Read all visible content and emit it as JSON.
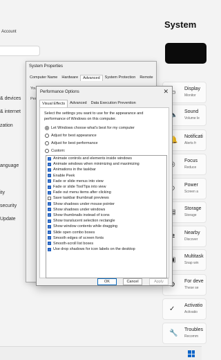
{
  "settings": {
    "account_label": "Account",
    "nav_items": [
      "& devices",
      "& internet",
      "zation",
      "anguage",
      "ity",
      "security",
      "Update"
    ],
    "system_title": "System",
    "cards": [
      {
        "icon": "display-icon",
        "glyph": "▭",
        "title": "Display",
        "sub": "Monitor"
      },
      {
        "icon": "sound-icon",
        "glyph": "🔈",
        "title": "Sound",
        "sub": "Volume le"
      },
      {
        "icon": "notifications-icon",
        "glyph": "🔔",
        "title": "Notificati",
        "sub": "Alerts fr"
      },
      {
        "icon": "focus-icon",
        "glyph": "◎",
        "title": "Focus",
        "sub": "Reduce"
      },
      {
        "icon": "power-icon",
        "glyph": "⏻",
        "title": "Power",
        "sub": "Screen a"
      },
      {
        "icon": "storage-icon",
        "glyph": "▤",
        "title": "Storage",
        "sub": "Storage"
      },
      {
        "icon": "nearby-sharing-icon",
        "glyph": "⇄",
        "title": "Nearby",
        "sub": "Discover"
      },
      {
        "icon": "multitasking-icon",
        "glyph": "▣",
        "title": "Multitask",
        "sub": "Snap win"
      },
      {
        "icon": "developers-icon",
        "glyph": "⚙",
        "title": "For deve",
        "sub": "These se"
      },
      {
        "icon": "activation-icon",
        "glyph": "✓",
        "title": "Activatio",
        "sub": "Activatio"
      },
      {
        "icon": "troubleshoot-icon",
        "glyph": "🔧",
        "title": "Troubles",
        "sub": "Recomm"
      }
    ]
  },
  "system_properties": {
    "title": "System Properties",
    "tabs": [
      "Computer Name",
      "Hardware",
      "Advanced",
      "System Protection",
      "Remote"
    ],
    "active_tab": 2,
    "body_lines": [
      "You",
      "Perfo"
    ]
  },
  "performance_options": {
    "title": "Performance Options",
    "close_glyph": "✕",
    "tabs": [
      "Visual Effects",
      "Advanced",
      "Data Execution Prevention"
    ],
    "active_tab": 0,
    "description": "Select the settings you want to use for the appearance and performance of Windows on this computer.",
    "radios": [
      {
        "label": "Let Windows choose what's best for my computer",
        "selected": true
      },
      {
        "label": "Adjust for best appearance",
        "selected": false
      },
      {
        "label": "Adjust for best performance",
        "selected": false
      },
      {
        "label": "Custom:",
        "selected": false
      }
    ],
    "options": [
      {
        "label": "Animate controls and elements inside windows",
        "checked": true
      },
      {
        "label": "Animate windows when minimizing and maximizing",
        "checked": true
      },
      {
        "label": "Animations in the taskbar",
        "checked": true
      },
      {
        "label": "Enable Peek",
        "checked": true
      },
      {
        "label": "Fade or slide menus into view",
        "checked": true
      },
      {
        "label": "Fade or slide ToolTips into view",
        "checked": true
      },
      {
        "label": "Fade out menu items after clicking",
        "checked": true
      },
      {
        "label": "Save taskbar thumbnail previews",
        "checked": false
      },
      {
        "label": "Show shadows under mouse pointer",
        "checked": true
      },
      {
        "label": "Show shadows under windows",
        "checked": true
      },
      {
        "label": "Show thumbnails instead of icons",
        "checked": true
      },
      {
        "label": "Show translucent selection rectangle",
        "checked": true
      },
      {
        "label": "Show window contents while dragging",
        "checked": true
      },
      {
        "label": "Slide open combo boxes",
        "checked": true
      },
      {
        "label": "Smooth edges of screen fonts",
        "checked": true
      },
      {
        "label": "Smooth-scroll list boxes",
        "checked": true
      },
      {
        "label": "Use drop shadows for icon labels on the desktop",
        "checked": true
      }
    ],
    "buttons": {
      "ok": "OK",
      "cancel": "Cancel",
      "apply": "Apply"
    }
  },
  "colors": {
    "accent": "#1f5fbf",
    "window_bg": "#f0f0f0"
  }
}
